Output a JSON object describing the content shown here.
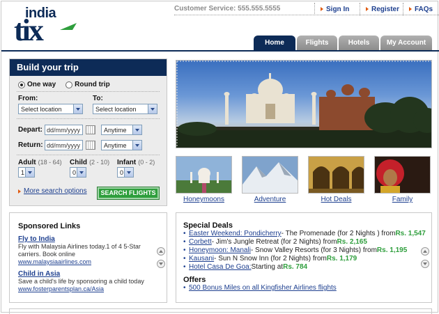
{
  "brand": {
    "line1": "india",
    "line2": "tix"
  },
  "topbar": {
    "customer_service": "Customer Service: 555.555.5555",
    "links": [
      "Sign In",
      "Register",
      "FAQs"
    ]
  },
  "nav": {
    "tabs": [
      "Home",
      "Flights",
      "Hotels",
      "My Account"
    ],
    "active": "Home"
  },
  "trip": {
    "title": "Build your trip",
    "one_way": "One way",
    "round_trip": "Round trip",
    "from_label": "From:",
    "to_label": "To:",
    "from_value": "Select location",
    "to_value": "Select location",
    "depart_label": "Depart:",
    "return_label": "Return:",
    "depart_date_placeholder": "dd/mm/yyyy",
    "return_date_placeholder": "dd/mm/yyyy",
    "depart_time": "Anytime",
    "return_time": "Anytime",
    "adult_label": "Adult",
    "adult_range": "(18 - 64)",
    "child_label": "Child",
    "child_range": "(2 - 10)",
    "infant_label": "Infant",
    "infant_range": "(0 - 2)",
    "adult_value": "1",
    "child_value": "0",
    "infant_value": "0",
    "more_options": "More search options",
    "search_button": "SEARCH FLIGHTS"
  },
  "thumbnails": [
    "Honeymoons",
    "Adventure",
    "Hot Deals",
    "Family"
  ],
  "sponsored": {
    "title": "Sponsored Links",
    "items": [
      {
        "title": "Fly to India",
        "text": "Fly with Malaysia Airlines today.1 of 4 5-Star carriers. Book online",
        "url": "www.malaysiaairlines.com"
      },
      {
        "title": "Child in Asia",
        "text": "Save a child's life by sponsoring a child today",
        "url": "www.fosterparentsplan.ca/Asia"
      }
    ]
  },
  "deals": {
    "title": "Special Deals",
    "items": [
      {
        "link": "Easter Weekend: Pondicherry",
        "text": " - The Promenade (for 2 Nights ) from ",
        "price": "Rs. 1,547"
      },
      {
        "link": "Corbett",
        "text": " - Jim's Jungle Retreat (for 2 Nights) from ",
        "price": "Rs. 2,165"
      },
      {
        "link": "Honeymoon: Manali",
        "text": " - Snow Valley Resorts (for 3 Nights) from ",
        "price": "Rs. 1,195"
      },
      {
        "link": "Kausani",
        "text": " - Sun N Snow Inn (for 2 Nights) from ",
        "price": "Rs. 1,179"
      },
      {
        "link": "Hotel Casa De Goa:",
        "text": " Starting at ",
        "price": "Rs. 784"
      }
    ],
    "offers_title": "Offers",
    "offers": [
      "500 Bonus Miles on all Kingfisher Airlines flights"
    ]
  },
  "colors": {
    "navy": "#0d2b57",
    "link": "#1d3f8f",
    "green": "#2e9e3c",
    "orange": "#e05a10"
  }
}
